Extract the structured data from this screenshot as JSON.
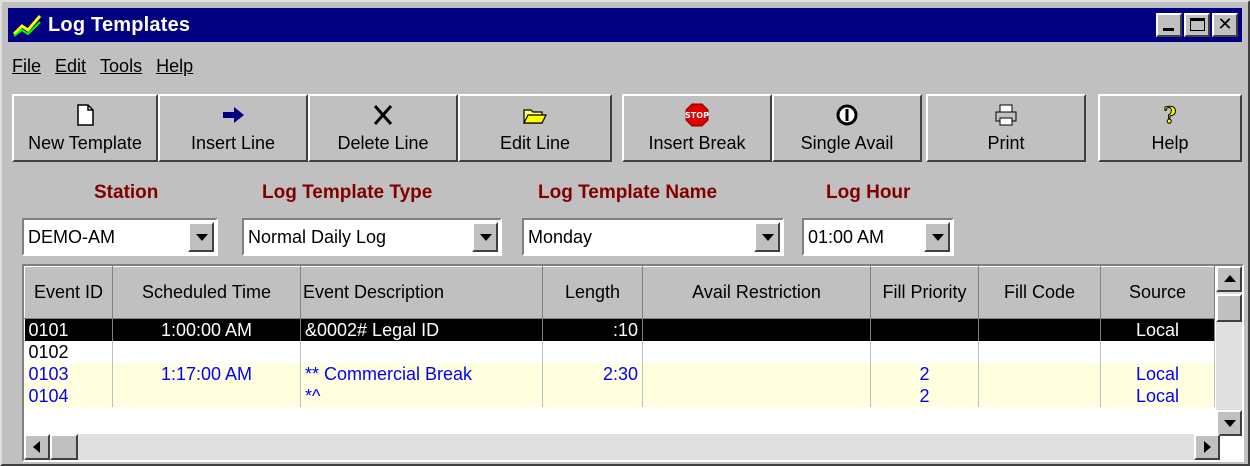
{
  "window": {
    "title": "Log Templates",
    "colors": {
      "titlebar": "#000080",
      "label": "#800000",
      "selection": "#000000",
      "row_highlight": "#ffffe0",
      "row_text_blue": "#0000ff"
    }
  },
  "menu": [
    "File",
    "Edit",
    "Tools",
    "Help"
  ],
  "toolbar": [
    {
      "label": "New Template",
      "icon": "new-document-icon"
    },
    {
      "label": "Insert Line",
      "icon": "arrow-right-icon"
    },
    {
      "label": "Delete Line",
      "icon": "x-icon"
    },
    {
      "label": "Edit Line",
      "icon": "folder-open-icon"
    },
    {
      "label": "Insert Break",
      "icon": "stop-sign-icon"
    },
    {
      "label": "Single Avail",
      "icon": "number-one-icon"
    },
    {
      "label": "Print",
      "icon": "printer-icon"
    },
    {
      "label": "Help",
      "icon": "question-icon"
    }
  ],
  "filters": {
    "station": {
      "label": "Station",
      "value": "DEMO-AM"
    },
    "template_type": {
      "label": "Log Template Type",
      "value": "Normal Daily Log"
    },
    "template_name": {
      "label": "Log Template Name",
      "value": "Monday"
    },
    "log_hour": {
      "label": "Log Hour",
      "value": "01:00 AM"
    }
  },
  "grid": {
    "columns": [
      "Event ID",
      "Scheduled Time",
      "Event Description",
      "Length",
      "Avail Restriction",
      "Fill Priority",
      "Fill Code",
      "Source"
    ],
    "rows": [
      {
        "style": "selected",
        "cells": [
          "0101",
          "1:00:00 AM",
          "&0002# Legal ID",
          ":10",
          "",
          "",
          "",
          "Local"
        ]
      },
      {
        "style": "white",
        "cells": [
          "0102",
          "",
          "",
          "",
          "",
          "",
          "",
          ""
        ]
      },
      {
        "style": "blue",
        "cells": [
          "0103",
          "1:17:00 AM",
          "** Commercial Break",
          "2:30",
          "",
          "2",
          "",
          "Local"
        ]
      },
      {
        "style": "blue",
        "cells": [
          "0104",
          "",
          "*^",
          "",
          "",
          "2",
          "",
          "Local"
        ]
      }
    ]
  }
}
